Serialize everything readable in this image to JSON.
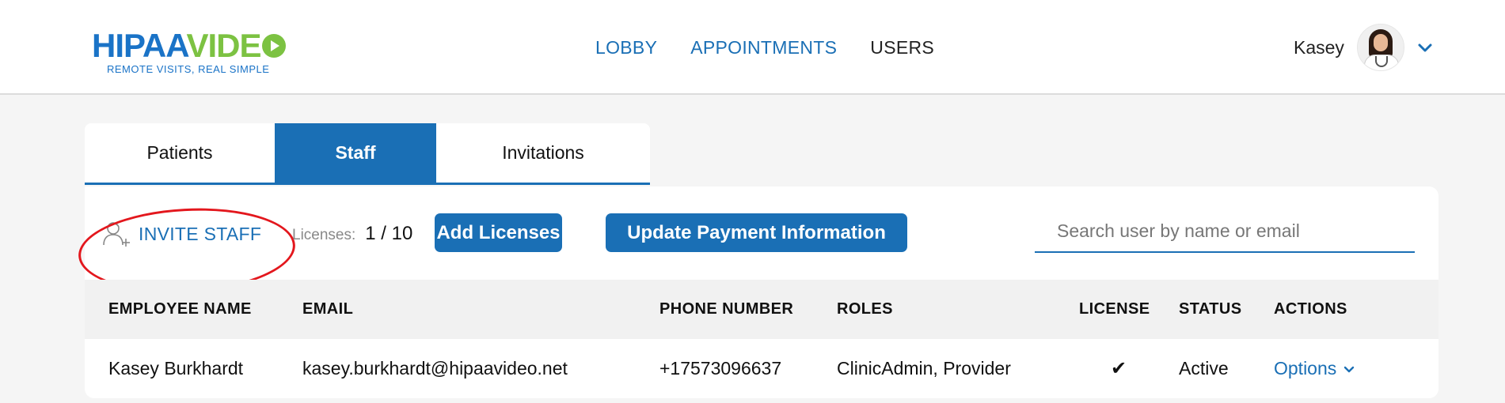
{
  "brand": {
    "logo_main_1": "HIPAA",
    "logo_main_2": "VIDE",
    "logo_tagline": "REMOTE VISITS, REAL SIMPLE"
  },
  "nav": {
    "lobby": "LOBBY",
    "appointments": "APPOINTMENTS",
    "users": "USERS"
  },
  "user": {
    "name": "Kasey"
  },
  "tabs": {
    "patients": "Patients",
    "staff": "Staff",
    "invitations": "Invitations"
  },
  "toolbar": {
    "invite_label": "INVITE STAFF",
    "licenses_label": "Licenses:",
    "licenses_value": "1 / 10",
    "add_licenses": "Add Licenses",
    "update_payment": "Update Payment Information",
    "search_placeholder": "Search user by name or email"
  },
  "table": {
    "headers": [
      "EMPLOYEE NAME",
      "EMAIL",
      "PHONE NUMBER",
      "ROLES",
      "LICENSE",
      "STATUS",
      "ACTIONS"
    ],
    "rows": [
      {
        "name": "Kasey Burkhardt",
        "email": "kasey.burkhardt@hipaavideo.net",
        "phone": "+17573096637",
        "roles": "ClinicAdmin, Provider",
        "license": "✔",
        "status": "Active",
        "actions": "Options"
      }
    ]
  },
  "colors": {
    "accent": "#1a6fb5",
    "brand_green": "#7cc242",
    "annotation": "#e3171d"
  },
  "icons": [
    "play-icon",
    "avatar",
    "chevron-down-icon",
    "add-user-icon",
    "check-icon"
  ]
}
